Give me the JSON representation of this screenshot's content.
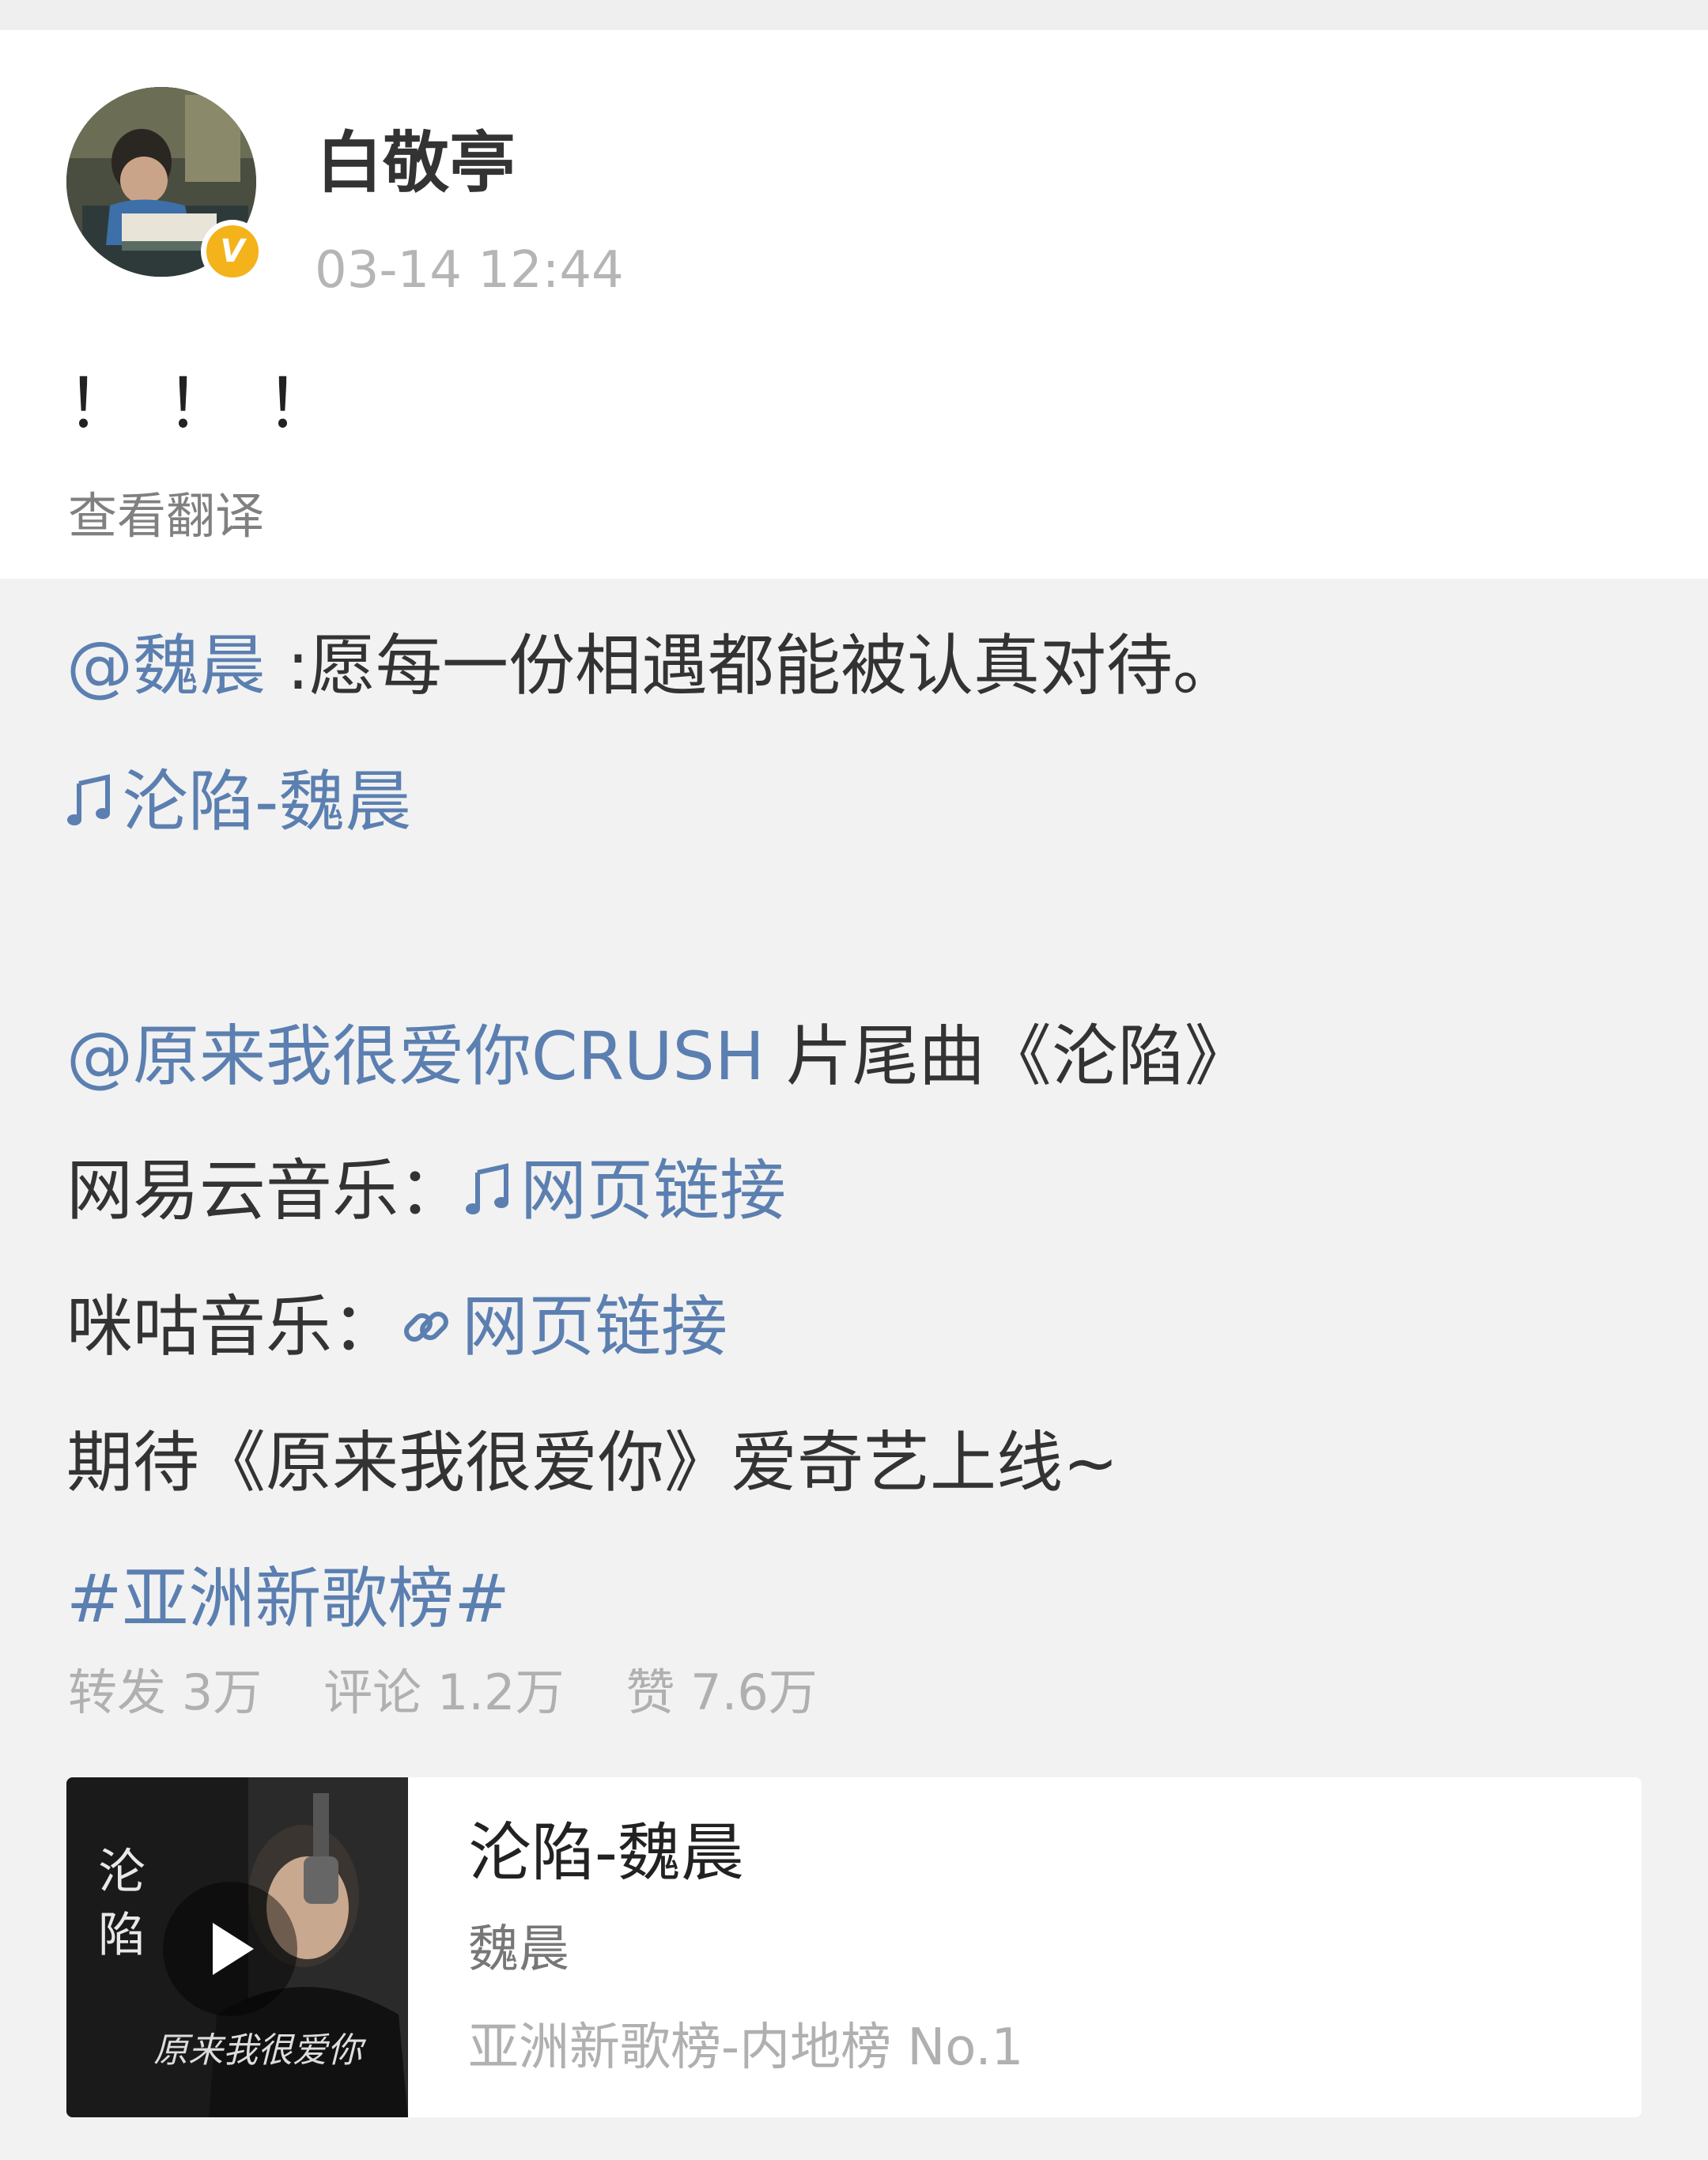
{
  "post": {
    "username": "白敬亭",
    "timestamp": "03-14 12:44",
    "text": "！！！",
    "translate_label": "查看翻译"
  },
  "repost": {
    "line1_mention": "@魏晨",
    "line1_text": " :愿每一份相遇都能被认真对待。",
    "line2_music_link": "沦陷-魏晨",
    "line3_mention": "@原来我很爱你CRUSH",
    "line3_text": " 片尾曲《沦陷》",
    "line4_prefix": "网易云音乐：",
    "line4_link": "网页链接",
    "line5_prefix": "咪咕音乐：",
    "line5_link": "网页链接",
    "line6_text": "期待《原来我很爱你》爱奇艺上线~",
    "line7_hashtag": "#亚洲新歌榜#",
    "stats": {
      "repost_label": "转发 3万",
      "comment_label": "评论 1.2万",
      "like_label": "赞 7.6万"
    }
  },
  "music_card": {
    "title": "沦陷-魏晨",
    "artist": "魏晨",
    "chart": "亚洲新歌榜-内地榜 No.1",
    "cover_text": {
      "vertical_title": "沦陷",
      "script_title": "原来我很爱你"
    }
  },
  "colors": {
    "link": "#5b7fb0",
    "verified": "#f4b21b",
    "muted": "#b0b0b0"
  },
  "icons": {
    "music_note": "music-note-icon",
    "link_chain": "link-icon",
    "play": "play-icon",
    "verified": "verified-badge-icon"
  }
}
